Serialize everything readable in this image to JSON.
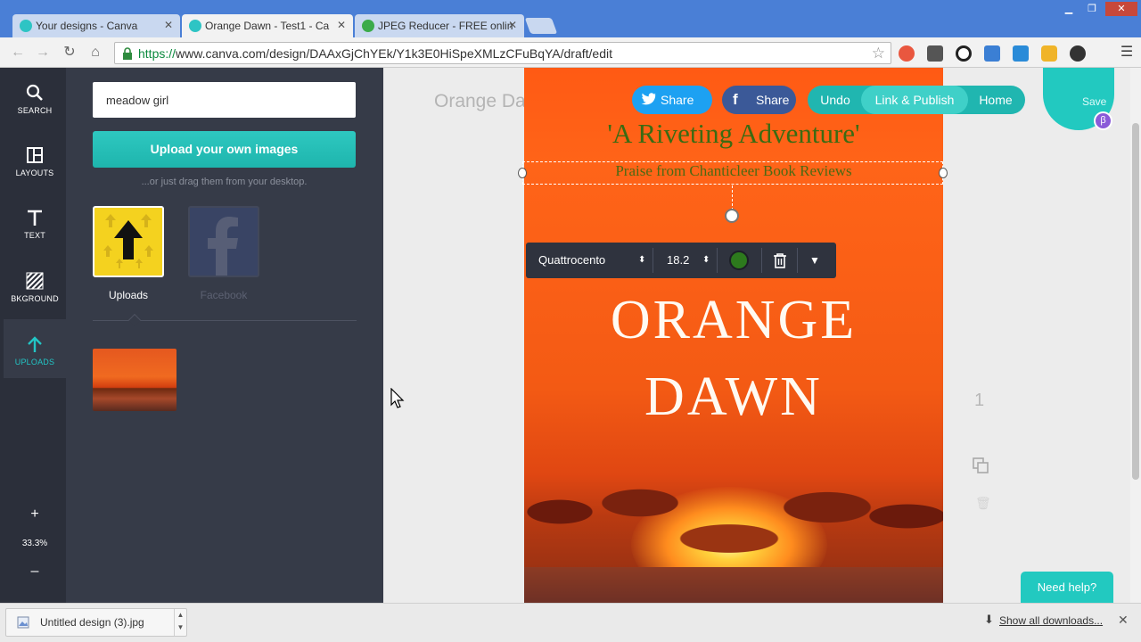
{
  "browser": {
    "tabs": [
      {
        "title": "Your designs - Canva",
        "active": false
      },
      {
        "title": "Orange Dawn - Test1 - Ca",
        "active": true
      },
      {
        "title": "JPEG Reducer - FREE onlin",
        "active": false
      }
    ],
    "url": {
      "scheme": "https://",
      "rest": "www.canva.com/design/DAAxGjChYEk/Y1k3E0HiSpeXMLzCFuBqYA/draft/edit"
    },
    "colors": {
      "chrome": "#4a7fd6",
      "https": "#0b8a3e"
    }
  },
  "rail": {
    "items": [
      {
        "label": "SEARCH",
        "icon": "search-icon"
      },
      {
        "label": "LAYOUTS",
        "icon": "layouts-icon"
      },
      {
        "label": "TEXT",
        "icon": "text-icon"
      },
      {
        "label": "BKGROUND",
        "icon": "background-icon"
      },
      {
        "label": "UPLOADS",
        "icon": "upload-icon"
      }
    ],
    "zoom": "33.3%",
    "zoom_in": "+",
    "zoom_out": "–"
  },
  "panel": {
    "search_value": "meadow girl",
    "upload_button": "Upload your own images",
    "drag_hint": "...or just drag them from your desktop.",
    "sources": [
      {
        "label": "Uploads",
        "active": true
      },
      {
        "label": "Facebook",
        "active": false
      }
    ]
  },
  "editor": {
    "design_title": "Orange Dawn - Test1",
    "share_twitter": "Share",
    "share_facebook": "Share",
    "undo": "Undo",
    "link_publish": "Link & Publish",
    "home": "Home",
    "save": "Save",
    "beta": "β",
    "page_number": "1",
    "need_help": "Need help?",
    "accent": "#22c9c0"
  },
  "design": {
    "tagline": "'A Riveting Adventure'",
    "praise": "Praise from Chanticleer Book Reviews",
    "title_line1": "ORANGE",
    "title_line2": "DAWN"
  },
  "format_bar": {
    "font": "Quattrocento",
    "size": "18.2",
    "color": "#2d7a1d"
  },
  "downloads": {
    "file": "Untitled design (3).jpg",
    "show_all": "Show all downloads..."
  }
}
